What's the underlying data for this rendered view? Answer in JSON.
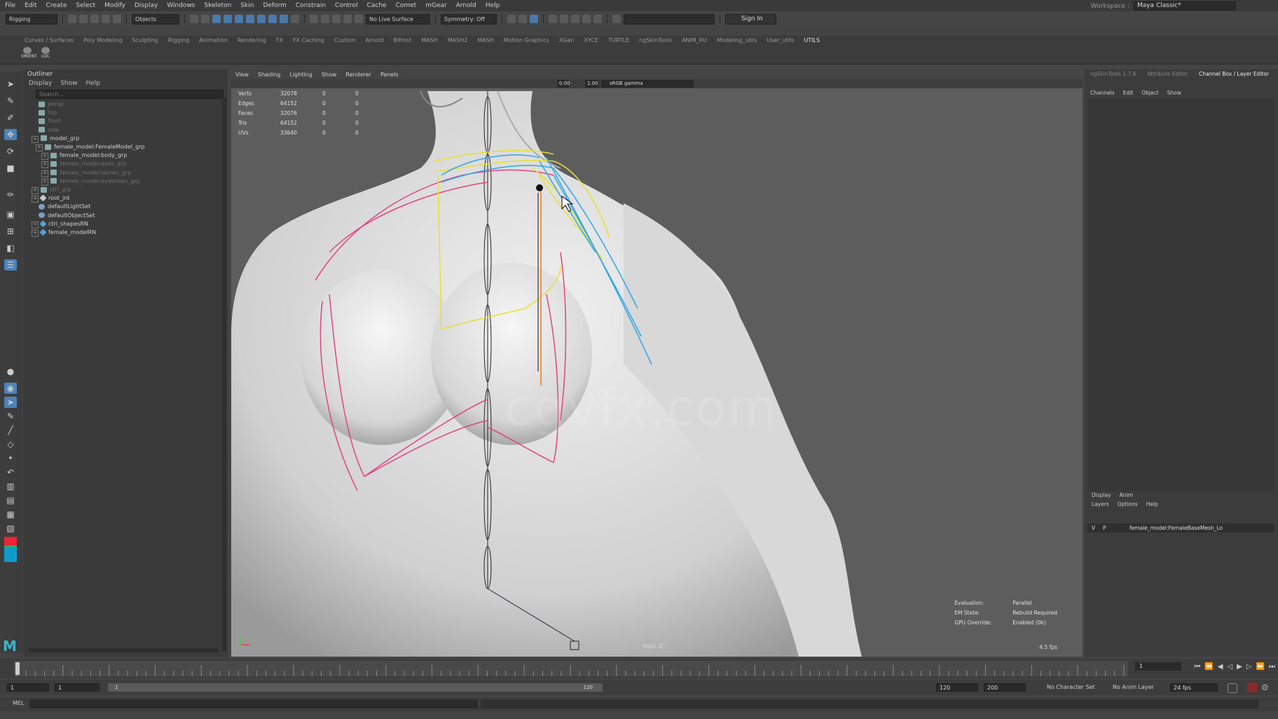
{
  "menubar": {
    "items": [
      "File",
      "Edit",
      "Create",
      "Select",
      "Modify",
      "Display",
      "Windows",
      "Skeleton",
      "Skin",
      "Deform",
      "Constrain",
      "Control",
      "Cache",
      "Comet",
      "mGear",
      "Arnold",
      "Help"
    ],
    "workspace_label": "Workspace :",
    "workspace_value": "Maya Classic*"
  },
  "statusline": {
    "menuset": "Rigging",
    "objects": "Objects",
    "live_surface": "No Live Surface",
    "symmetry": "Symmetry: Off",
    "sign_in": "Sign In"
  },
  "shelf": {
    "tabs": [
      "Curves / Surfaces",
      "Poly Modeling",
      "Sculpting",
      "Rigging",
      "Animation",
      "Rendering",
      "FX",
      "FX Caching",
      "Custom",
      "Arnold",
      "Bifrost",
      "MASH",
      "MASH2",
      "MASH",
      "Motion Graphics",
      "XGen",
      "XYCE",
      "TURTLE",
      "ngSkinTools",
      "ANIM_RU",
      "Modeling_utils",
      "User_utils",
      "UTILS"
    ],
    "active_tab": "UTILS",
    "buttons": [
      "ORIENT",
      "LOC"
    ]
  },
  "outliner": {
    "title": "Outliner",
    "menu": [
      "Display",
      "Show",
      "Help"
    ],
    "search_placeholder": "Search...",
    "nodes": [
      {
        "label": "persp",
        "dim": true
      },
      {
        "label": "top",
        "dim": true
      },
      {
        "label": "front",
        "dim": true
      },
      {
        "label": "side",
        "dim": true
      },
      {
        "label": "model_grp",
        "dim": false
      },
      {
        "label": "female_model:FemaleModel_grp",
        "dim": false
      },
      {
        "label": "female_model:body_grp",
        "dim": false
      },
      {
        "label": "female_model:eyes_grp",
        "dim": true
      },
      {
        "label": "female_model:lashes_grp",
        "dim": true
      },
      {
        "label": "female_model:eyebrows_grp",
        "dim": true
      },
      {
        "label": "ctrl_grp",
        "dim": true
      },
      {
        "label": "root_jnt",
        "dim": false
      },
      {
        "label": "defaultLightSet",
        "dim": false
      },
      {
        "label": "defaultObjectSet",
        "dim": false
      },
      {
        "label": "ctrl_shapesRN",
        "dim": false
      },
      {
        "label": "female_modelRN",
        "dim": false
      }
    ]
  },
  "viewport": {
    "menu": [
      "View",
      "Shading",
      "Lighting",
      "Show",
      "Renderer",
      "Panels"
    ],
    "exposure": "0.00",
    "gamma": "1.00",
    "colorspace": "sRGB gamma",
    "stats": [
      {
        "label": "Verts",
        "v": "32078",
        "a": "0",
        "b": "0"
      },
      {
        "label": "Edges",
        "v": "64152",
        "a": "0",
        "b": "0"
      },
      {
        "label": "Faces",
        "v": "32076",
        "a": "0",
        "b": "0"
      },
      {
        "label": "Tris",
        "v": "64152",
        "a": "0",
        "b": "0"
      },
      {
        "label": "UVs",
        "v": "33640",
        "a": "0",
        "b": "0"
      }
    ],
    "hud": [
      {
        "label": "Evaluation:",
        "value": "Parallel"
      },
      {
        "label": "EM State:",
        "value": "Rebuild Required"
      },
      {
        "label": "GPU Override:",
        "value": "Enabled (0k)"
      }
    ],
    "camera": "front -Z",
    "fps": "4.5 fps",
    "watermark": "cgvfx.com"
  },
  "channelbox": {
    "tabs": [
      "ngSkinTools 1.7.6",
      "Attribute Editor",
      "Channel Box / Layer Editor"
    ],
    "active_tab": "Channel Box / Layer Editor",
    "menu": [
      "Channels",
      "Edit",
      "Object",
      "Show"
    ],
    "layer_tabs": [
      "Display",
      "Anim"
    ],
    "layer_menu": [
      "Layers",
      "Options",
      "Help"
    ],
    "layer": {
      "v": "V",
      "p": "P",
      "name": "female_model:FemaleBaseMesh_Lo"
    }
  },
  "timeline": {
    "current_frame": "1"
  },
  "range": {
    "start": "1",
    "inner_start": "1",
    "slider_start": "1",
    "slider_end": "120",
    "end_a": "120",
    "end_b": "200",
    "character_set": "No Character Set",
    "anim_layer": "No Anim Layer",
    "fps": "24 fps"
  },
  "cmdline": {
    "label": "MEL"
  },
  "colors": {
    "viewport_bg": "#5d5d5d",
    "pink_curve": "#e0457f",
    "yellow_curve": "#e8e032",
    "blue_curve": "#2ea7e6",
    "accent": "#4b82b8"
  }
}
